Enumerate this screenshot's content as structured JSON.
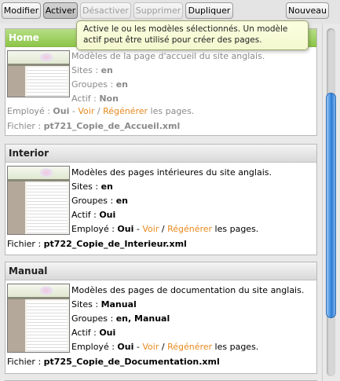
{
  "toolbar": {
    "buttons": [
      {
        "label": "Modifier",
        "state": "normal"
      },
      {
        "label": "Activer",
        "state": "active"
      },
      {
        "label": "Désactiver",
        "state": "disabled"
      },
      {
        "label": "Supprimer",
        "state": "disabled"
      },
      {
        "label": "Dupliquer",
        "state": "normal"
      },
      {
        "label": "Nouveau",
        "state": "normal"
      }
    ]
  },
  "tooltip": {
    "text": "Active le ou les modèles sélectionnés. Un modèle actif peut être utilisé pour créer des pages."
  },
  "labels": {
    "sites": "Sites :",
    "groups": "Groupes :",
    "active": "Actif :",
    "employed": "Employé :",
    "file": "Fichier :",
    "view": "Voir",
    "regenerate": "Régénérer",
    "pages_suffix": "les pages.",
    "dash": "-",
    "slash": "/"
  },
  "templates": [
    {
      "title": "Home",
      "description": "Modèles de la page d'accueil du site anglais.",
      "sites": "en",
      "groups": "en",
      "active": "Non",
      "employed": "Oui",
      "file": "pt721_Copie_de_Accueil.xml",
      "selected": true
    },
    {
      "title": "Interior",
      "description": "Modèles des pages intérieures du site anglais.",
      "sites": "en",
      "groups": "en",
      "active": "Oui",
      "employed": "Oui",
      "file": "pt722_Copie_de_Interieur.xml",
      "selected": false
    },
    {
      "title": "Manual",
      "description": "Modèles des pages de documentation du site anglais.",
      "sites": "Manual",
      "groups": "en, Manual",
      "active": "Oui",
      "employed": "Oui",
      "file": "pt725_Copie_de_Documentation.xml",
      "selected": false
    }
  ],
  "colors": {
    "selected_header": "#8cc548",
    "link": "#e8891e",
    "scroll_thumb": "#3f8fe2"
  }
}
